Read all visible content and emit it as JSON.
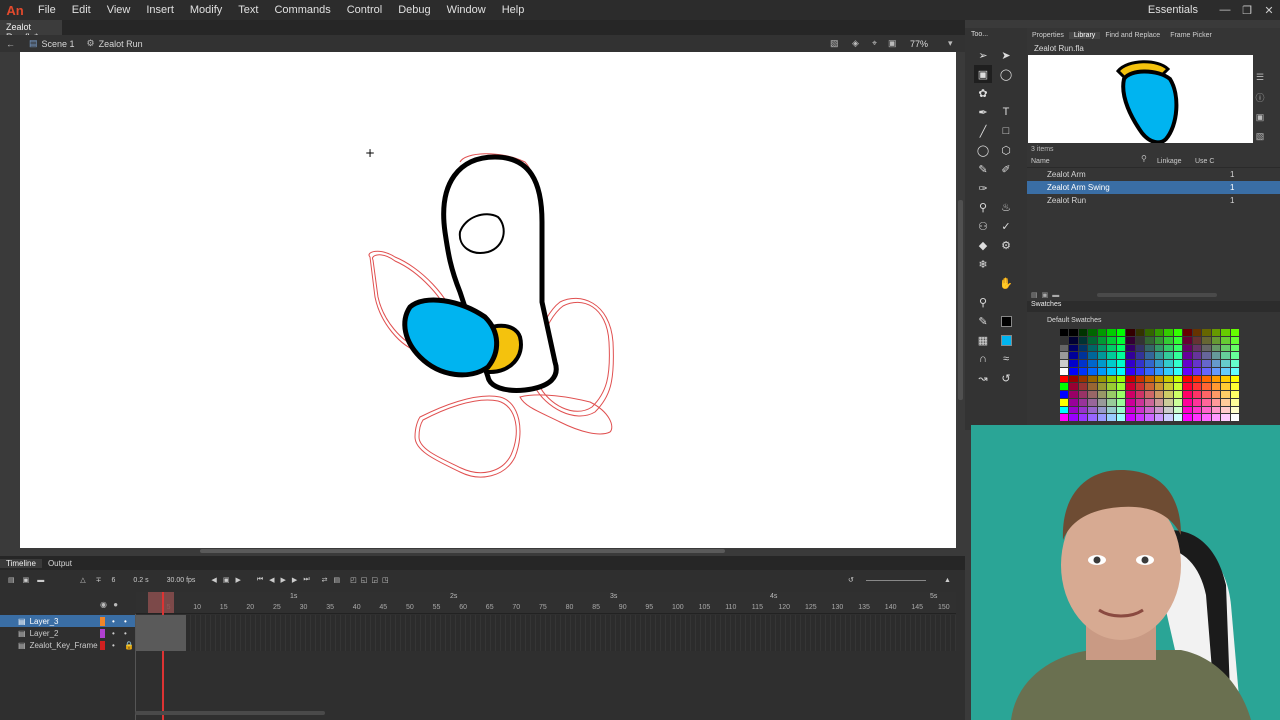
{
  "menubar": {
    "logo": "An",
    "items": [
      "File",
      "Edit",
      "View",
      "Insert",
      "Modify",
      "Text",
      "Commands",
      "Control",
      "Debug",
      "Window",
      "Help"
    ],
    "workspace": "Essentials"
  },
  "document": {
    "tab_title": "Zealot Run.fla*",
    "scene": "Scene 1",
    "symbol": "Zealot Run",
    "zoom": "77%"
  },
  "timeline": {
    "tabs": [
      "Timeline",
      "Output"
    ],
    "current_frame": "6",
    "elapsed_time": "0.2 s",
    "frame_rate": "30.00 fps",
    "ruler_seconds": [
      "1s",
      "2s",
      "3s",
      "4s",
      "5s"
    ],
    "ruler_frames": [
      "5",
      "10",
      "15",
      "20",
      "25",
      "30",
      "35",
      "40",
      "45",
      "50",
      "55",
      "60",
      "65",
      "70",
      "75",
      "80",
      "85",
      "90",
      "95",
      "100",
      "105",
      "110",
      "115",
      "120",
      "125",
      "130",
      "135",
      "140",
      "145",
      "150"
    ],
    "layers": [
      {
        "name": "Layer_3",
        "color": "#f0852a",
        "selected": true
      },
      {
        "name": "Layer_2",
        "color": "#b040d0",
        "selected": false
      },
      {
        "name": "Zealot_Key_Frame",
        "color": "#d02020",
        "selected": false
      }
    ]
  },
  "panels": {
    "tools_title": "Too...",
    "tabs": [
      "Properties",
      "Library",
      "Find and Replace",
      "Frame Picker"
    ],
    "active_tab": "Library",
    "library": {
      "document": "Zealot Run.fla",
      "item_count": "3 items",
      "columns": [
        "Name",
        "Linkage",
        "Use C"
      ],
      "items": [
        {
          "name": "Zealot Arm",
          "use": "1"
        },
        {
          "name": "Zealot Arm Swing",
          "use": "1"
        },
        {
          "name": "Zealot Run",
          "use": "1"
        }
      ],
      "selected_index": 1
    },
    "swatches": {
      "tab": "Swatches",
      "group": "Default Swatches"
    }
  },
  "colors": {
    "accent_selection": "#3a6ea5",
    "fill_blue": "#00b4f0",
    "fill_yellow": "#f4c20d",
    "onion_red": "#e05050"
  }
}
